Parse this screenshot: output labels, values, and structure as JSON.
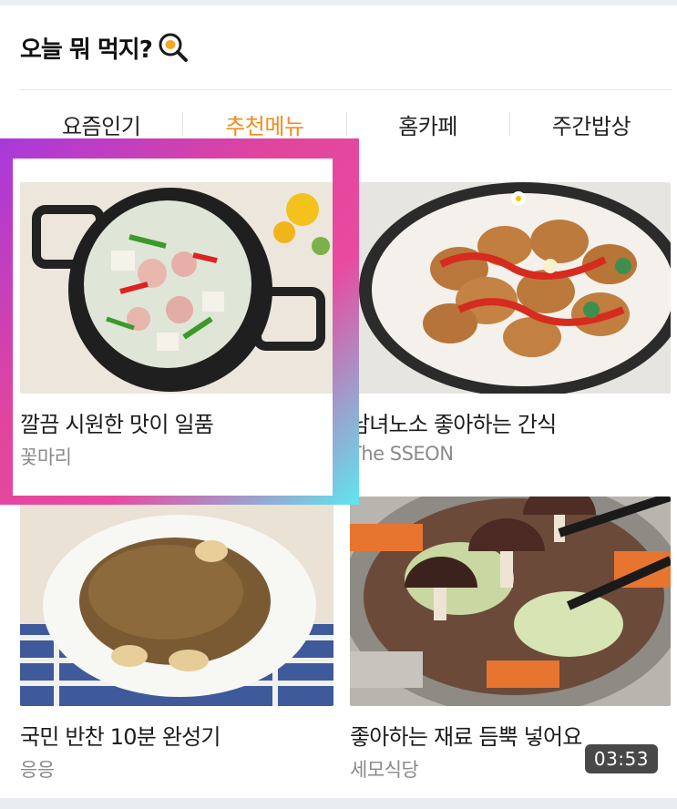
{
  "header": {
    "title": "오늘 뭐 먹지?",
    "icon": "frying-pan-icon"
  },
  "tabs": [
    {
      "label": "요즘인기",
      "active": false
    },
    {
      "label": "추천메뉴",
      "active": true
    },
    {
      "label": "홈카페",
      "active": false
    },
    {
      "label": "주간밥상",
      "active": false
    }
  ],
  "cards": [
    {
      "title": "깔끔 시원한 맛이 일품",
      "author": "꽃마리",
      "highlighted": true
    },
    {
      "title": "남녀노소 좋아하는 간식",
      "author": "The SSEON"
    },
    {
      "title": "국민 반찬 10분 완성기",
      "author": "응응"
    },
    {
      "title": "좋아하는 재료 듬뿍 넣어요",
      "author": "세모식당",
      "duration": "03:53"
    }
  ],
  "colors": {
    "active_tab": "#f28c1e",
    "highlight_gradient": [
      "#b13ad8",
      "#e2459c",
      "#5ee6f0"
    ]
  }
}
